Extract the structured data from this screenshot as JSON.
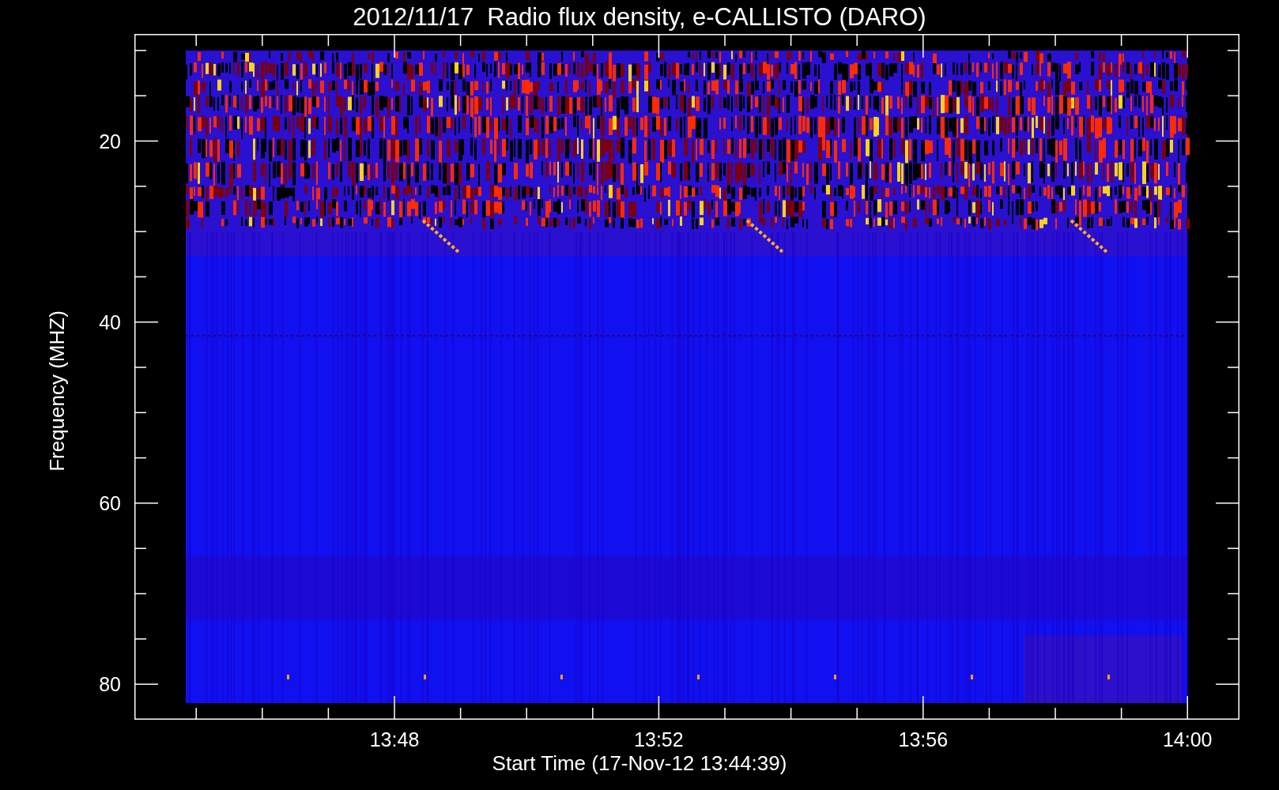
{
  "title": "2012/11/17  Radio flux density, e-CALLISTO (DARO)",
  "y_axis": {
    "label": "Frequency (MHZ)",
    "ticks": [
      "20",
      "40",
      "60",
      "80"
    ]
  },
  "x_axis": {
    "label": "Start Time (17-Nov-12 13:44:39)",
    "ticks": [
      "13:48",
      "13:52",
      "13:56",
      "14:00"
    ]
  }
}
